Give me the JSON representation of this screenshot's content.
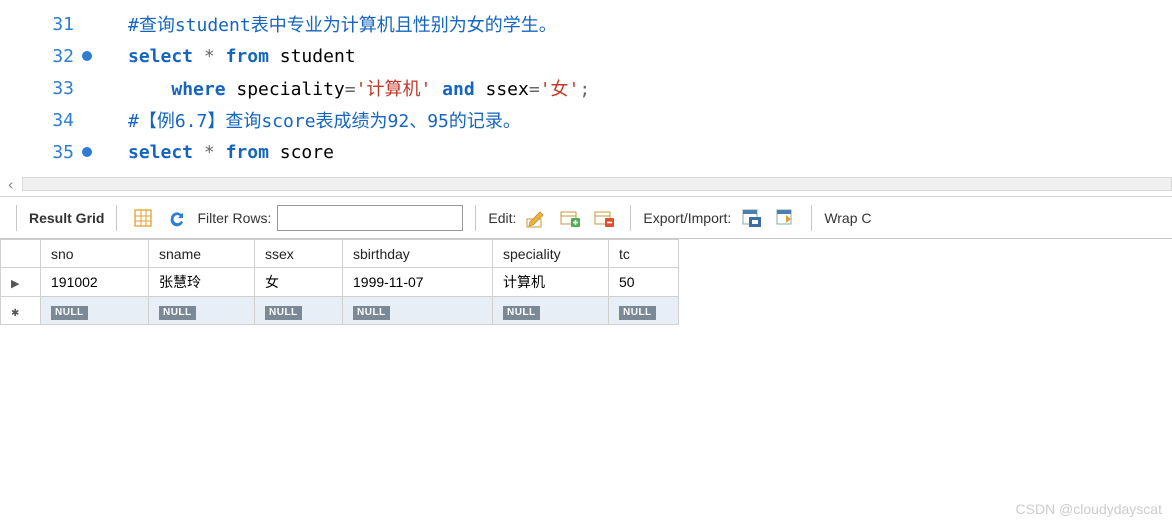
{
  "editor": {
    "lines": [
      {
        "num": "31",
        "bp": false,
        "tokens": [
          {
            "cls": "comment",
            "t": "#查询student表中专业为计算机且性别为女的学生。"
          }
        ]
      },
      {
        "num": "32",
        "bp": true,
        "tokens": [
          {
            "cls": "kw",
            "t": "select"
          },
          {
            "cls": "ident",
            "t": " "
          },
          {
            "cls": "op",
            "t": "*"
          },
          {
            "cls": "ident",
            "t": " "
          },
          {
            "cls": "kw",
            "t": "from"
          },
          {
            "cls": "ident",
            "t": " student"
          }
        ]
      },
      {
        "num": "33",
        "bp": false,
        "tokens": [
          {
            "cls": "ident",
            "t": "    "
          },
          {
            "cls": "kw",
            "t": "where"
          },
          {
            "cls": "ident",
            "t": " speciality"
          },
          {
            "cls": "op",
            "t": "="
          },
          {
            "cls": "str",
            "t": "'计算机'"
          },
          {
            "cls": "ident",
            "t": " "
          },
          {
            "cls": "kw",
            "t": "and"
          },
          {
            "cls": "ident",
            "t": " ssex"
          },
          {
            "cls": "op",
            "t": "="
          },
          {
            "cls": "str",
            "t": "'女'"
          },
          {
            "cls": "op",
            "t": ";"
          }
        ]
      },
      {
        "num": "34",
        "bp": false,
        "tokens": [
          {
            "cls": "comment",
            "t": "#【例6.7】查询score表成绩为92、95的记录。"
          }
        ]
      },
      {
        "num": "35",
        "bp": true,
        "tokens": [
          {
            "cls": "kw",
            "t": "select"
          },
          {
            "cls": "ident",
            "t": " "
          },
          {
            "cls": "op",
            "t": "*"
          },
          {
            "cls": "ident",
            "t": " "
          },
          {
            "cls": "kw",
            "t": "from"
          },
          {
            "cls": "ident",
            "t": " score"
          }
        ]
      }
    ]
  },
  "toolbar": {
    "result_grid_label": "Result Grid",
    "filter_label": "Filter Rows:",
    "filter_value": "",
    "edit_label": "Edit:",
    "export_label": "Export/Import:",
    "wrap_label": "Wrap C"
  },
  "grid": {
    "columns": [
      "sno",
      "sname",
      "ssex",
      "sbirthday",
      "speciality",
      "tc"
    ],
    "rows": [
      {
        "marker": "current",
        "cells": [
          "191002",
          "张慧玲",
          "女",
          "1999-11-07",
          "计算机",
          "50"
        ]
      },
      {
        "marker": "new",
        "cells": [
          "NULL",
          "NULL",
          "NULL",
          "NULL",
          "NULL",
          "NULL"
        ],
        "null_row": true
      }
    ]
  },
  "watermark": "CSDN @cloudydayscat"
}
